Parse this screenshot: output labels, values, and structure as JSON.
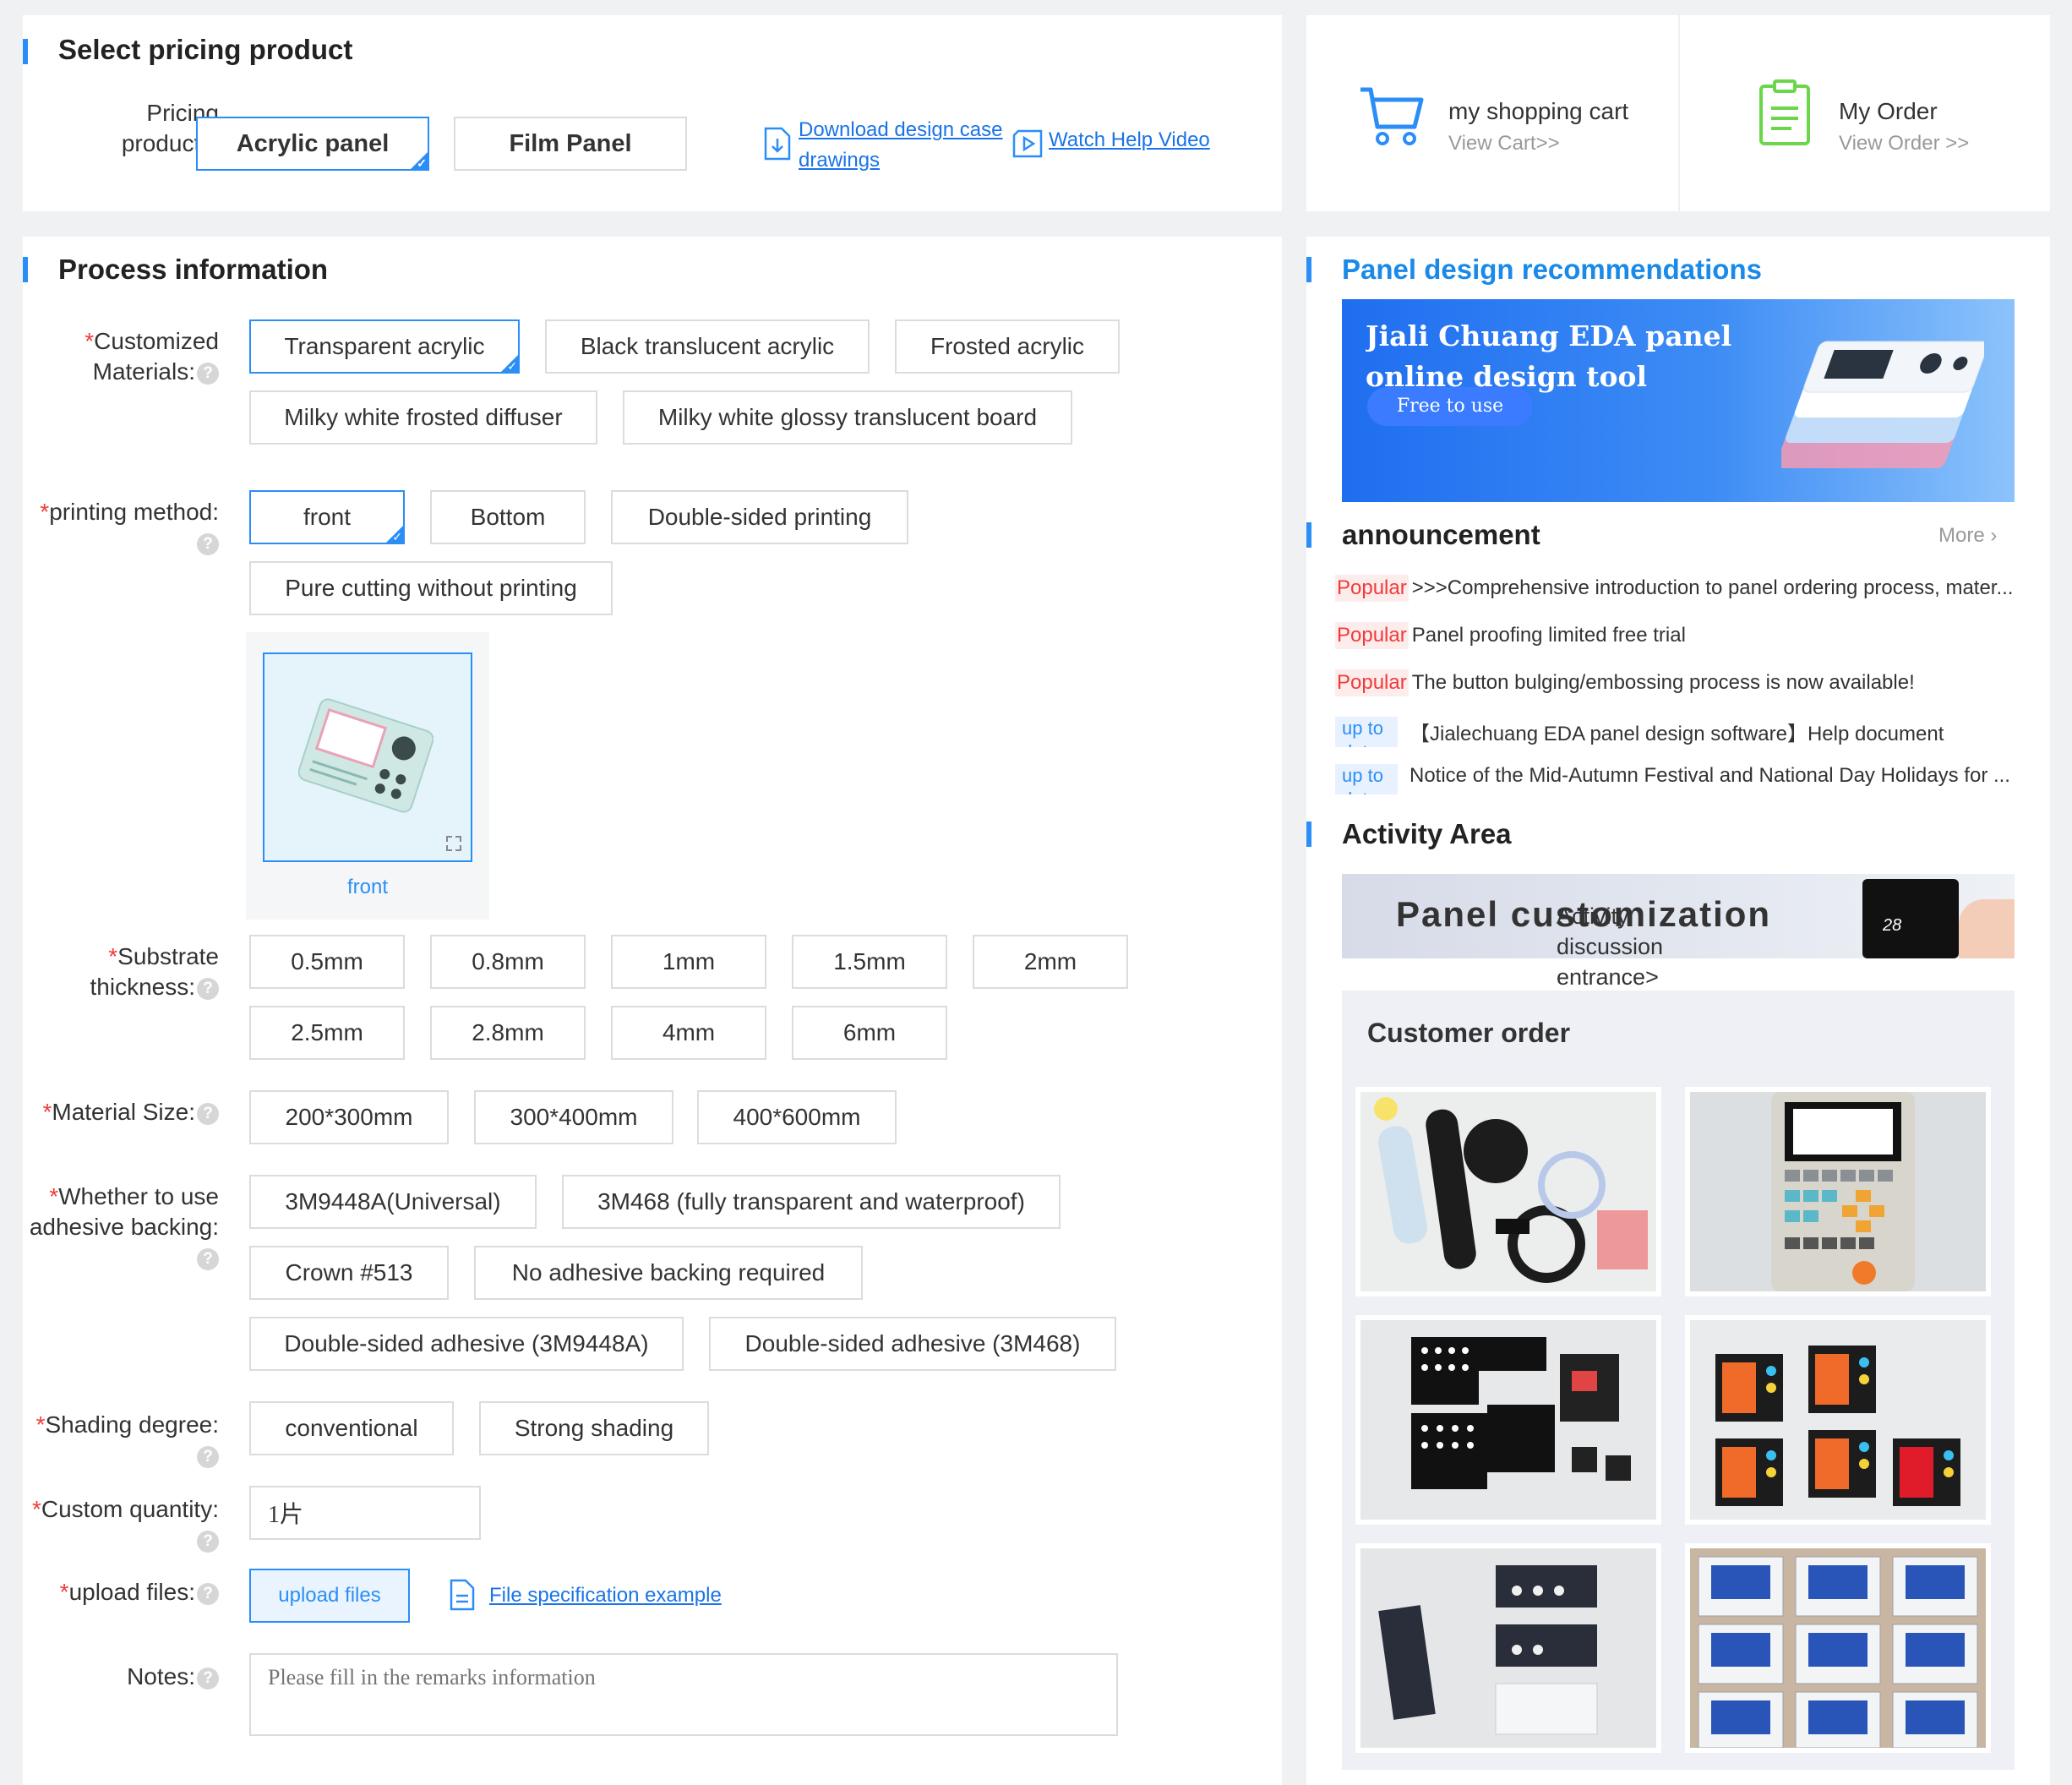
{
  "pricing": {
    "title": "Select pricing product",
    "label": "Pricing products:",
    "options": [
      "Acrylic panel",
      "Film Panel"
    ],
    "selected": 0,
    "download_link": "Download design case drawings",
    "help_link": "Watch Help Video"
  },
  "cart": {
    "title": "my shopping cart",
    "sub": "View Cart>>"
  },
  "order": {
    "title": "My Order",
    "sub": "View Order >>"
  },
  "process": {
    "title": "Process information",
    "materials": {
      "label": "Customized Materials:",
      "options": [
        "Transparent acrylic",
        "Black translucent acrylic",
        "Frosted acrylic",
        "Milky white frosted diffuser",
        "Milky white glossy translucent board"
      ]
    },
    "printing": {
      "label": "printing method:",
      "options": [
        "front",
        "Bottom",
        "Double-sided printing",
        "Pure cutting without printing"
      ],
      "preview_caption": "front"
    },
    "thickness": {
      "label": "Substrate thickness:",
      "options": [
        "0.5mm",
        "0.8mm",
        "1mm",
        "1.5mm",
        "2mm",
        "2.5mm",
        "2.8mm",
        "4mm",
        "6mm"
      ]
    },
    "size": {
      "label": "Material Size:",
      "options": [
        "200*300mm",
        "300*400mm",
        "400*600mm"
      ]
    },
    "adhesive": {
      "label": "Whether to use adhesive backing:",
      "options": [
        "3M9448A(Universal)",
        "3M468 (fully transparent and waterproof)",
        "Crown #513",
        "No adhesive backing required",
        "Double-sided adhesive (3M9448A)",
        "Double-sided adhesive (3M468)"
      ]
    },
    "shading": {
      "label": "Shading degree:",
      "options": [
        "conventional",
        "Strong shading"
      ]
    },
    "quantity": {
      "label": "Custom quantity:",
      "value": "1片"
    },
    "upload": {
      "label": "upload files:",
      "button": "upload files",
      "example_link": "File specification example"
    },
    "notes": {
      "label": "Notes:",
      "placeholder": "Please fill in the remarks information"
    }
  },
  "recommend": {
    "title": "Panel design recommendations",
    "banner_title": "Jiali Chuang EDA panel online design tool",
    "banner_button": "Free to use"
  },
  "announcement": {
    "title": "announcement",
    "more": "More",
    "items": [
      {
        "tag": "Popular",
        "text": ">>>Comprehensive introduction to panel ordering process, mater..."
      },
      {
        "tag": "Popular",
        "text": "Panel proofing limited free trial"
      },
      {
        "tag": "Popular",
        "text": "The button bulging/embossing process is now available!"
      },
      {
        "tag": "up to date",
        "text": "【Jialechuang EDA panel design software】Help document"
      },
      {
        "tag": "up to date",
        "text": "Notice of the Mid-Autumn Festival and National Day Holidays for ..."
      }
    ]
  },
  "activity": {
    "title": "Activity Area",
    "banner_title": "Panel customization",
    "banner_overlay": "Activity discussion entrance>",
    "device_display": "28"
  },
  "customer_order": {
    "title": "Customer order"
  },
  "colors": {
    "accent": "#2b8ef7",
    "required": "#f23a3a",
    "link": "#1a73e8"
  }
}
